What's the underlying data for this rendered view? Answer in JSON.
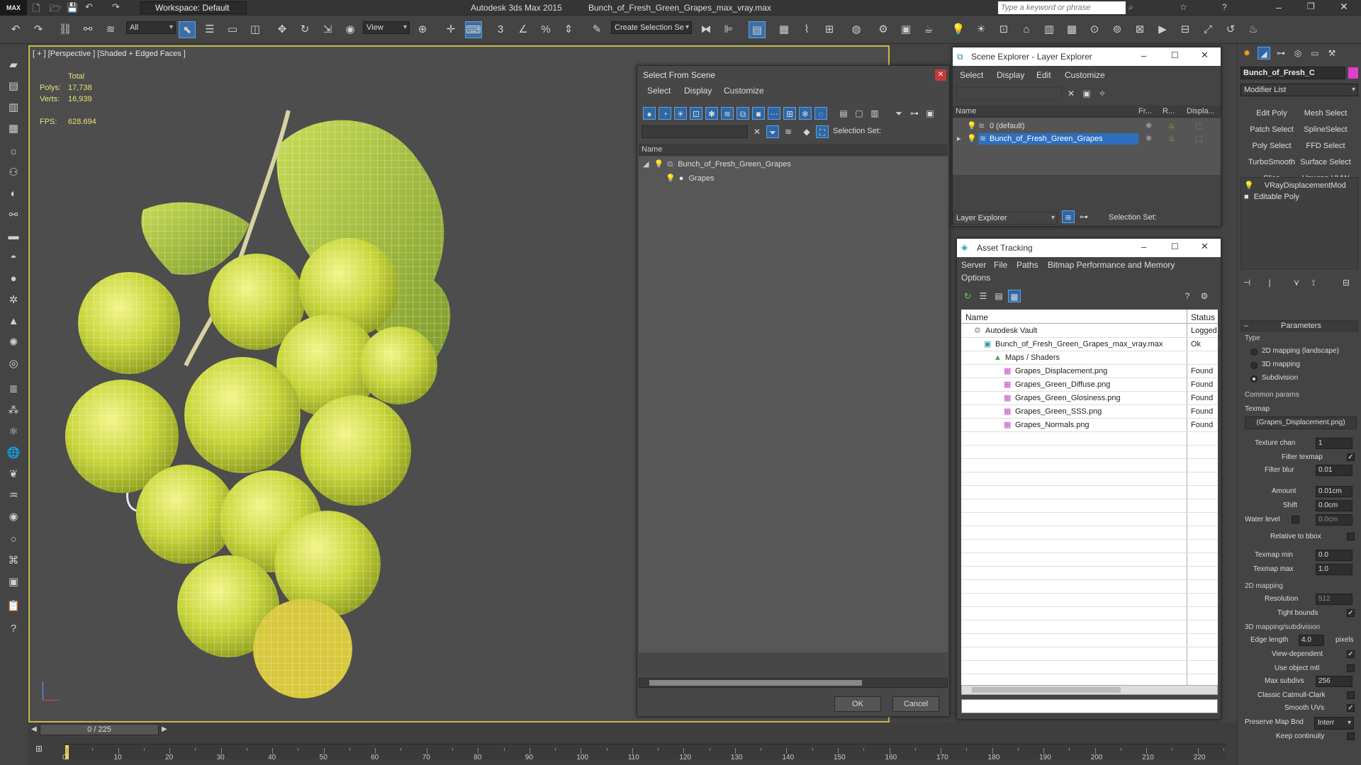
{
  "titlebar": {
    "app_title": "Autodesk 3ds Max  2015",
    "file_title": "Bunch_of_Fresh_Green_Grapes_max_vray.max",
    "workspace": "Workspace: Default",
    "search_placeholder": "Type a keyword or phrase",
    "logo": "MAX"
  },
  "toolbar": {
    "filter_value": "All",
    "view_value": "View",
    "selection_set_value": "Create Selection Se",
    "snap_label": "3",
    "percent_snap": "%"
  },
  "viewport": {
    "label": "[ + ] [Perspective ] [Shaded + Edged Faces ]",
    "stats": {
      "total_label": "Total",
      "polys_label": "Polys:",
      "polys_value": "17,738",
      "verts_label": "Verts:",
      "verts_value": "16,939",
      "fps_label": "FPS:",
      "fps_value": "628.694"
    },
    "colors": {
      "grape": "#c8d63a",
      "leaf": "#9fc23a",
      "wire": "#ffffff",
      "border": "#c8b94a"
    }
  },
  "select_from_scene": {
    "title": "Select From Scene",
    "menu": [
      "Select",
      "Display",
      "Customize"
    ],
    "selection_set_label": "Selection Set:",
    "column_name": "Name",
    "tree": [
      {
        "label": "Bunch_of_Fresh_Green_Grapes",
        "level": 0
      },
      {
        "label": "Grapes",
        "level": 1
      }
    ],
    "ok_label": "OK",
    "cancel_label": "Cancel"
  },
  "scene_explorer": {
    "title": "Scene Explorer - Layer Explorer",
    "menu": [
      "Select",
      "Display",
      "Edit",
      "Customize"
    ],
    "columns": [
      "Name",
      "Fr...",
      "R...",
      "Displa..."
    ],
    "rows": [
      {
        "label": "0 (default)",
        "selected": false
      },
      {
        "label": "Bunch_of_Fresh_Green_Grapes",
        "selected": true
      }
    ],
    "footer_combo": "Layer Explorer",
    "selection_set_label": "Selection Set:"
  },
  "asset_tracking": {
    "title": "Asset Tracking",
    "menu": [
      "Server",
      "File",
      "Paths",
      "Bitmap Performance and Memory",
      "Options"
    ],
    "columns": [
      "Name",
      "Status"
    ],
    "rows": [
      {
        "label": "Autodesk Vault",
        "status": "Logged",
        "level": 0
      },
      {
        "label": "Bunch_of_Fresh_Green_Grapes_max_vray.max",
        "status": "Ok",
        "level": 1
      },
      {
        "label": "Maps / Shaders",
        "status": "",
        "level": 2
      },
      {
        "label": "Grapes_Displacement.png",
        "status": "Found",
        "level": 3
      },
      {
        "label": "Grapes_Green_Diffuse.png",
        "status": "Found",
        "level": 3
      },
      {
        "label": "Grapes_Green_Glosiness.png",
        "status": "Found",
        "level": 3
      },
      {
        "label": "Grapes_Green_SSS.png",
        "status": "Found",
        "level": 3
      },
      {
        "label": "Grapes_Normals.png",
        "status": "Found",
        "level": 3
      }
    ]
  },
  "command_panel": {
    "object_name": "Bunch_of_Fresh_C",
    "object_color": "#e040c8",
    "modifier_list": "Modifier List",
    "modifier_buttons": [
      "Edit Poly",
      "Mesh Select",
      "Patch Select",
      "SplineSelect",
      "Poly Select",
      "FFD Select",
      "TurboSmooth",
      "Surface Select",
      "Slice",
      "Unwrap UVW"
    ],
    "stack": [
      "VRayDisplacementMod",
      "Editable Poly"
    ],
    "parameters_title": "Parameters",
    "type_label": "Type",
    "type_options": [
      "2D mapping (landscape)",
      "3D mapping",
      "Subdivision"
    ],
    "type_selected": 2,
    "common_params": "Common params",
    "texmap_label": "Texmap",
    "texmap_value": "(Grapes_Displacement.png)",
    "texture_chan_label": "Texture chan",
    "texture_chan_value": "1",
    "filter_texmap_label": "Filter texmap",
    "filter_blur_label": "Filter blur",
    "filter_blur_value": "0.01",
    "amount_label": "Amount",
    "amount_value": "0.01cm",
    "shift_label": "Shift",
    "shift_value": "0.0cm",
    "water_level_label": "Water level",
    "water_level_value": "0.0cm",
    "relative_bbox_label": "Relative to bbox",
    "texmap_min_label": "Texmap min",
    "texmap_min_value": "0.0",
    "texmap_max_label": "Texmap max",
    "texmap_max_value": "1.0",
    "mapping_2d": "2D mapping",
    "resolution_label": "Resolution",
    "resolution_value": "512",
    "tight_bounds_label": "Tight bounds",
    "mapping_3d": "3D mapping/subdivision",
    "edge_length_label": "Edge length",
    "edge_length_value": "4.0",
    "pixels_label": "pixels",
    "view_dependent_label": "View-dependent",
    "use_object_mtl_label": "Use object mtl",
    "max_subdivs_label": "Max subdivs",
    "max_subdivs_value": "256",
    "classic_catmull_label": "Classic Catmull-Clark",
    "smooth_uvs_label": "Smooth UVs",
    "preserve_map_label": "Preserve Map Bnd",
    "preserve_map_value": "Interr",
    "keep_continuity_label": "Keep continuity"
  },
  "timeline": {
    "frame_counter": "0 / 225",
    "ticks": [
      "0",
      "10",
      "20",
      "30",
      "40",
      "50",
      "60",
      "70",
      "80",
      "90",
      "100",
      "110",
      "120",
      "130",
      "140",
      "150",
      "160",
      "170",
      "180",
      "190",
      "200",
      "210",
      "220"
    ]
  }
}
